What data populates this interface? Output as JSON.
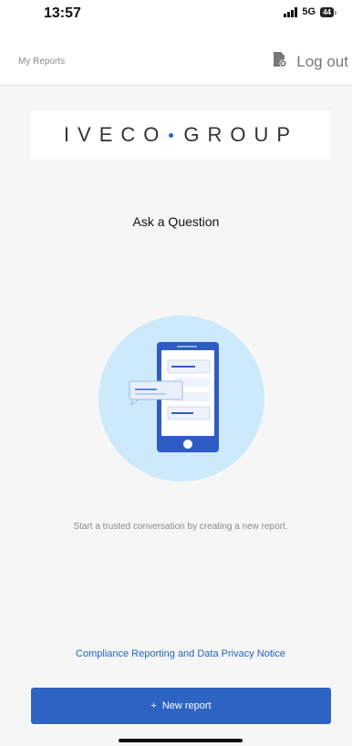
{
  "status_bar": {
    "time": "13:57",
    "network": "5G",
    "battery": "44"
  },
  "header": {
    "title": "My Reports",
    "logout_label": "Log out"
  },
  "logo": {
    "left_text": "IVECO",
    "right_text": "GROUP",
    "dot_color": "#1c6ad3"
  },
  "main": {
    "title": "Ask a Question",
    "empty_message": "Start a trusted conversation by creating a new report.",
    "privacy_link": "Compliance Reporting and Data Privacy Notice",
    "new_report_label": "New report",
    "new_report_icon": "+"
  },
  "colors": {
    "accent": "#2d64c3",
    "link": "#2463c2",
    "illustration_circle": "#cdeafb",
    "phone_body": "#2f5cc4"
  }
}
